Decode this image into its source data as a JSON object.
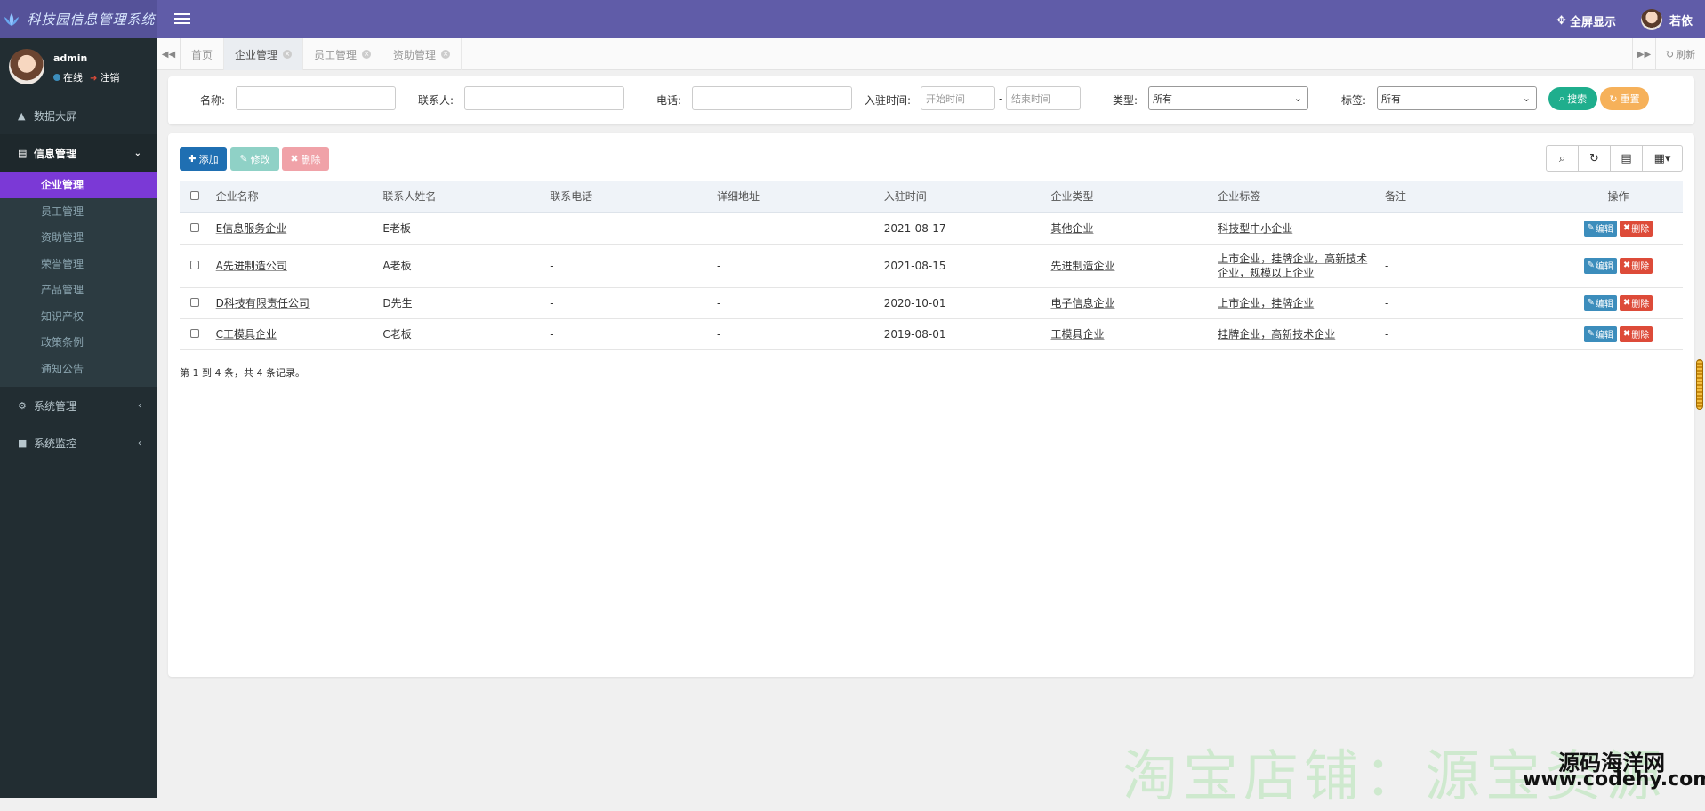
{
  "app": {
    "logo_text": "科技园信息管理系统"
  },
  "header": {
    "fullscreen_label": "全屏显示",
    "user_name": "若依"
  },
  "sidebar": {
    "user": {
      "name": "admin",
      "status": "在线",
      "logout": "注销"
    },
    "menu": [
      {
        "label": "数据大屏",
        "icon": "area-chart-icon"
      },
      {
        "label": "信息管理",
        "icon": "list-alt-icon",
        "open": true
      },
      {
        "label": "系统管理",
        "icon": "gear-icon"
      },
      {
        "label": "系统监控",
        "icon": "video-camera-icon"
      }
    ],
    "submenu": [
      "企业管理",
      "员工管理",
      "资助管理",
      "荣誉管理",
      "产品管理",
      "知识产权",
      "政策条例",
      "通知公告"
    ]
  },
  "tabs": {
    "items": [
      "首页",
      "企业管理",
      "员工管理",
      "资助管理"
    ],
    "refresh": "刷新"
  },
  "search": {
    "name_label": "名称:",
    "contact_label": "联系人:",
    "phone_label": "电话:",
    "join_time_label": "入驻时间:",
    "start_placeholder": "开始时间",
    "end_placeholder": "结束时间",
    "range_sep": "-",
    "type_label": "类型:",
    "type_value": "所有",
    "tag_label": "标签:",
    "tag_value": "所有",
    "search_btn": "搜索",
    "reset_btn": "重置"
  },
  "toolbar": {
    "add": "添加",
    "edit": "修改",
    "delete": "删除"
  },
  "table": {
    "headers": [
      "企业名称",
      "联系人姓名",
      "联系电话",
      "详细地址",
      "入驻时间",
      "企业类型",
      "企业标签",
      "备注",
      "操作"
    ],
    "rows": [
      {
        "name": "E信息服务企业",
        "contact": "E老板",
        "phone": "-",
        "address": "-",
        "date": "2021-08-17",
        "type": "其他企业",
        "tags": "科技型中小企业",
        "note": "-"
      },
      {
        "name": "A先进制造公司",
        "contact": "A老板",
        "phone": "-",
        "address": "-",
        "date": "2021-08-15",
        "type": "先进制造企业",
        "tags": "上市企业，挂牌企业，高新技术企业，规模以上企业",
        "note": "-"
      },
      {
        "name": "D科技有限责任公司",
        "contact": "D先生",
        "phone": "-",
        "address": "-",
        "date": "2020-10-01",
        "type": "电子信息企业",
        "tags": "上市企业，挂牌企业",
        "note": "-"
      },
      {
        "name": "C工模具企业",
        "contact": "C老板",
        "phone": "-",
        "address": "-",
        "date": "2019-08-01",
        "type": "工模具企业",
        "tags": "挂牌企业，高新技术企业",
        "note": "-"
      }
    ],
    "edit_label": "编辑",
    "delete_label": "删除",
    "pagination": "第 1 到 4 条，共 4 条记录。"
  },
  "watermark": {
    "big": "淘宝店铺：源宝资源",
    "site_cn": "源码海洋网",
    "site_url": "www.codehy.com"
  }
}
